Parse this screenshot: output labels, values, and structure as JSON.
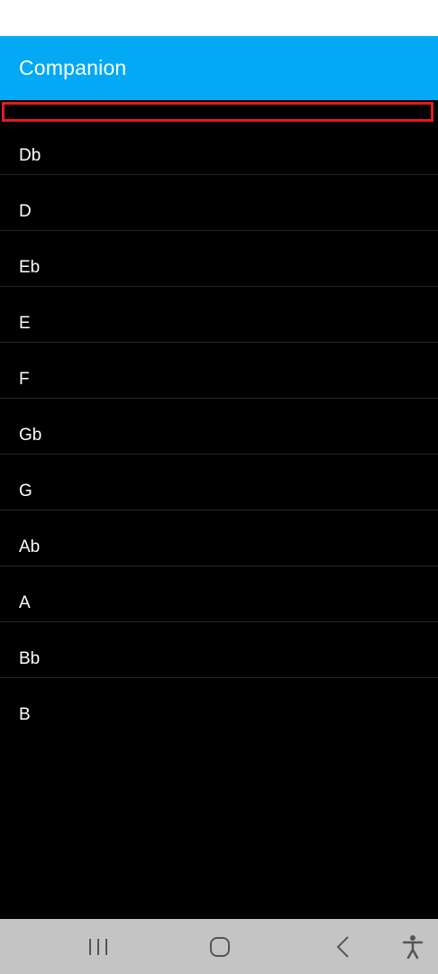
{
  "app": {
    "title": "Companion"
  },
  "list": {
    "items": [
      {
        "label": ""
      },
      {
        "label": "Db"
      },
      {
        "label": "D"
      },
      {
        "label": "Eb"
      },
      {
        "label": "E"
      },
      {
        "label": "F"
      },
      {
        "label": "Gb"
      },
      {
        "label": "G"
      },
      {
        "label": "Ab"
      },
      {
        "label": "A"
      },
      {
        "label": "Bb"
      },
      {
        "label": "B"
      }
    ]
  },
  "nav": {
    "buttons": [
      "recent-apps-icon",
      "home-icon",
      "back-icon",
      "accessibility-icon"
    ]
  },
  "colors": {
    "app_bar": "#03a9f4",
    "list_background": "#000000",
    "highlight_border": "#e01d1d",
    "nav_bar": "#c4c4c4"
  }
}
